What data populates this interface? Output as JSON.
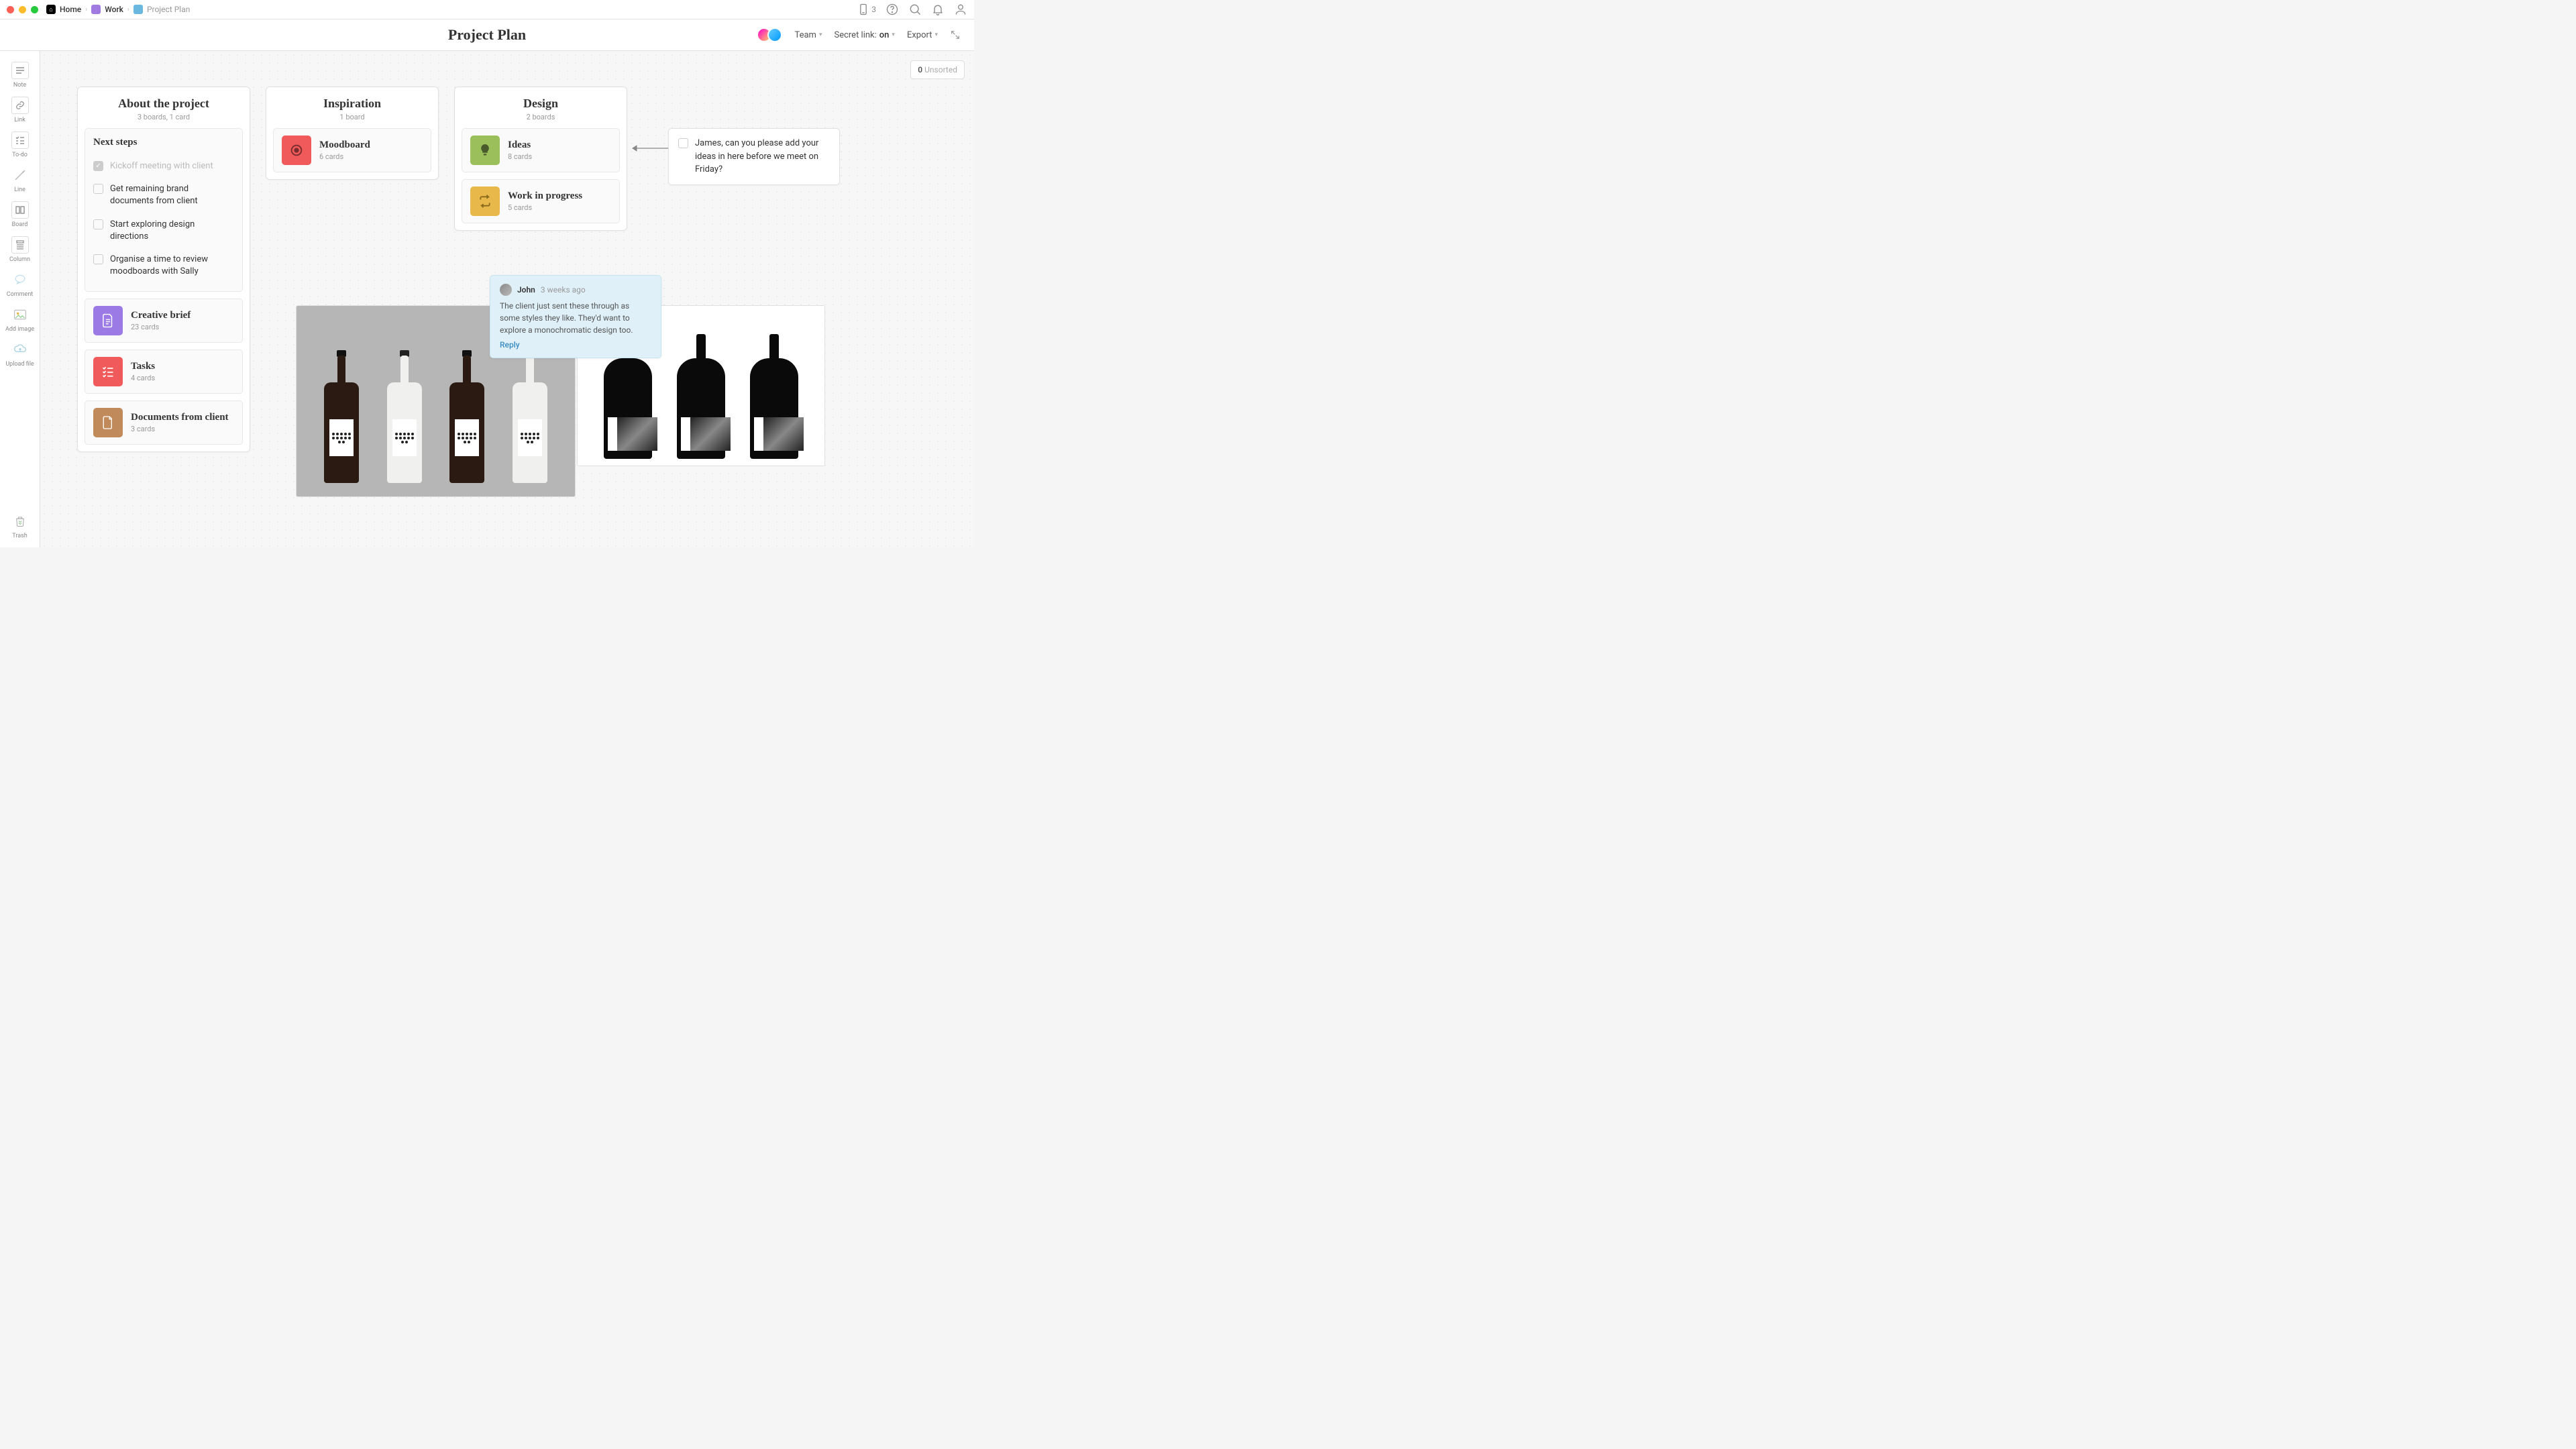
{
  "breadcrumb": {
    "home": "Home",
    "work": "Work",
    "project": "Project Plan"
  },
  "titlebar": {
    "device_count": "3"
  },
  "header": {
    "title": "Project Plan",
    "team": "Team",
    "secret_link_label": "Secret link:",
    "secret_link_value": "on",
    "export": "Export"
  },
  "sidebar": {
    "note": "Note",
    "link": "Link",
    "todo": "To-do",
    "line": "Line",
    "board": "Board",
    "column": "Column",
    "comment": "Comment",
    "add_image": "Add image",
    "upload_file": "Upload file",
    "trash": "Trash"
  },
  "unsorted": {
    "count": "0",
    "label": "Unsorted"
  },
  "boards": {
    "about": {
      "title": "About the project",
      "subtitle": "3 boards, 1 card",
      "next_steps": {
        "title": "Next steps",
        "items": [
          {
            "done": true,
            "text": "Kickoff meeting with client"
          },
          {
            "done": false,
            "text": "Get remaining brand documents from client"
          },
          {
            "done": false,
            "text": "Start exploring design directions"
          },
          {
            "done": false,
            "text": "Organise a time to review moodboards with Sally"
          }
        ]
      },
      "brief": {
        "title": "Creative brief",
        "sub": "23 cards",
        "color": "#9c7ae6"
      },
      "tasks": {
        "title": "Tasks",
        "sub": "4 cards",
        "color": "#f05a5a"
      },
      "docs": {
        "title": "Documents from client",
        "sub": "3 cards",
        "color": "#c08a5a"
      }
    },
    "inspiration": {
      "title": "Inspiration",
      "subtitle": "1 board",
      "moodboard": {
        "title": "Moodboard",
        "sub": "6 cards",
        "color": "#f05a5a"
      }
    },
    "design": {
      "title": "Design",
      "subtitle": "2 boards",
      "ideas": {
        "title": "Ideas",
        "sub": "8 cards",
        "color": "#9bbf5a"
      },
      "wip": {
        "title": "Work in progress",
        "sub": "5 cards",
        "color": "#e8b84a"
      }
    }
  },
  "sticky_note": {
    "text": "James, can you please add your ideas in here before we meet on Friday?"
  },
  "comment": {
    "author": "John",
    "time": "3 weeks ago",
    "body": "The client just sent these through as some styles they like. They'd want to explore a monochromatic design too.",
    "reply": "Reply"
  }
}
